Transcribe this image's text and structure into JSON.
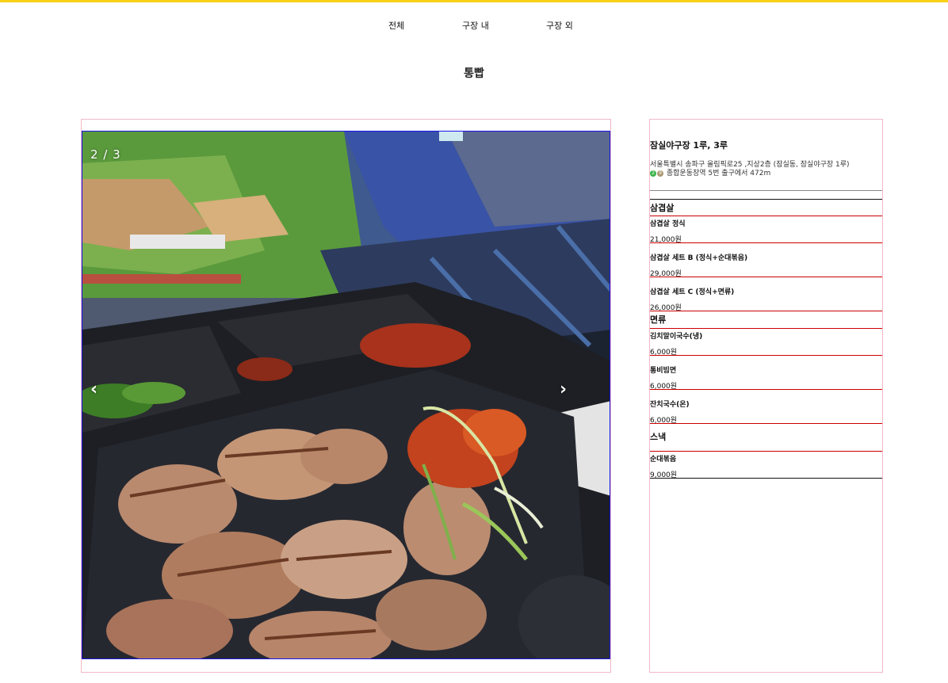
{
  "nav": {
    "items": [
      {
        "label": "전체"
      },
      {
        "label": "구장 내"
      },
      {
        "label": "구장 외"
      }
    ]
  },
  "page_title": "통빱",
  "gallery": {
    "counter": "2 / 3",
    "prev_icon": "‹",
    "next_icon": "›"
  },
  "info": {
    "stadium": "잠실야구장 1루, 3루",
    "address": "서울특별시 송파구 올림픽로25 ,지상2층 (잠실동, 잠실야구장 1루)",
    "station": {
      "line_numbers": [
        "2",
        "9"
      ],
      "line_colors": [
        "#3cb44a",
        "#aa9872"
      ],
      "text": "종합운동장역 5번 출구에서 472m"
    }
  },
  "menu": {
    "categories": [
      {
        "name": "삼겹살",
        "items": [
          {
            "name": "삼겹살 정식",
            "price": "21,000원"
          },
          {
            "name": "삼겹살 세트 B (정식+순대볶음)",
            "price": "29,000원"
          },
          {
            "name": "삼겹살 세트 C (정식+면류)",
            "price": "26,000원"
          }
        ]
      },
      {
        "name": "면류",
        "items": [
          {
            "name": "김치말이국수(냉)",
            "price": "6,000원"
          },
          {
            "name": "통비빔면",
            "price": "6,000원"
          },
          {
            "name": "잔치국수(온)",
            "price": "6,000원"
          }
        ]
      },
      {
        "name": "스낵",
        "items": [
          {
            "name": "순대볶음",
            "price": "9,000원"
          }
        ]
      }
    ]
  },
  "colors": {
    "accent": "#f7d117",
    "frame_border": "#f2b8c6",
    "photo_border": "#1a14e6",
    "divider_red": "#cc0000"
  }
}
